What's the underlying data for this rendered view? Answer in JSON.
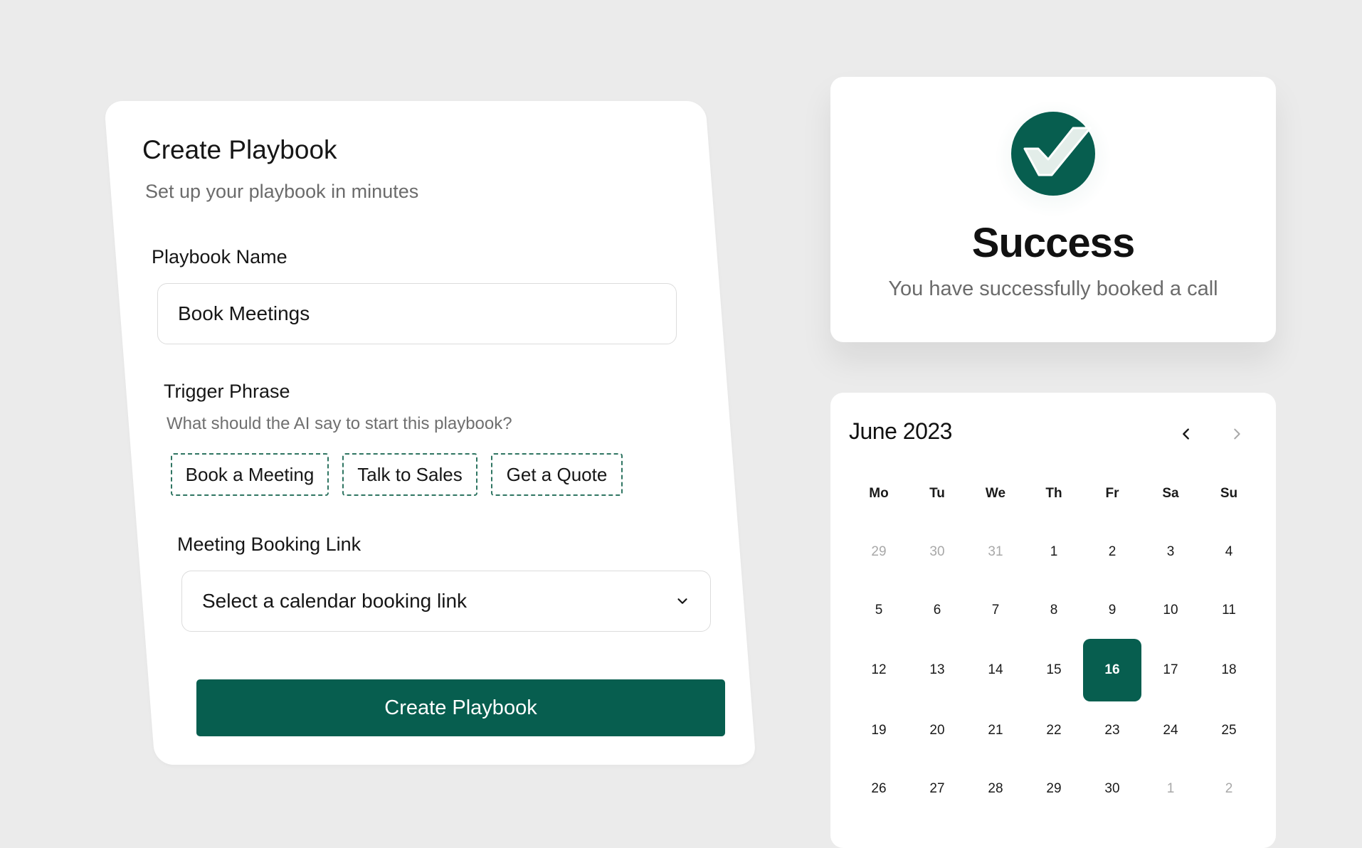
{
  "playbook_form": {
    "title": "Create Playbook",
    "subtitle": "Set up your playbook in minutes",
    "name_label": "Playbook Name",
    "name_value": "Book Meetings",
    "trigger_label": "Trigger Phrase",
    "trigger_hint": "What should the AI say to start this playbook?",
    "trigger_chips": [
      "Book a Meeting",
      "Talk to Sales",
      "Get a Quote"
    ],
    "booking_label": "Meeting Booking Link",
    "booking_selected": "Select a calendar booking link",
    "submit_label": "Create Playbook"
  },
  "success": {
    "icon": "check-circle-icon",
    "title": "Success",
    "message": "You have successfully booked a call"
  },
  "calendar": {
    "month_label": "June 2023",
    "weekdays": [
      "Mo",
      "Tu",
      "We",
      "Th",
      "Fr",
      "Sa",
      "Su"
    ],
    "weeks": [
      [
        "29",
        "30",
        "31",
        "1",
        "2",
        "3",
        "4"
      ],
      [
        "5",
        "6",
        "7",
        "8",
        "9",
        "10",
        "11"
      ],
      [
        "12",
        "13",
        "14",
        "15",
        "16",
        "17",
        "18"
      ],
      [
        "19",
        "20",
        "21",
        "22",
        "23",
        "24",
        "25"
      ],
      [
        "26",
        "27",
        "28",
        "29",
        "30",
        "1",
        "2"
      ]
    ],
    "selected_day": "16"
  },
  "colors": {
    "accent": "#075e4f",
    "background": "#ebebeb",
    "muted_text": "#6b6b6b"
  }
}
